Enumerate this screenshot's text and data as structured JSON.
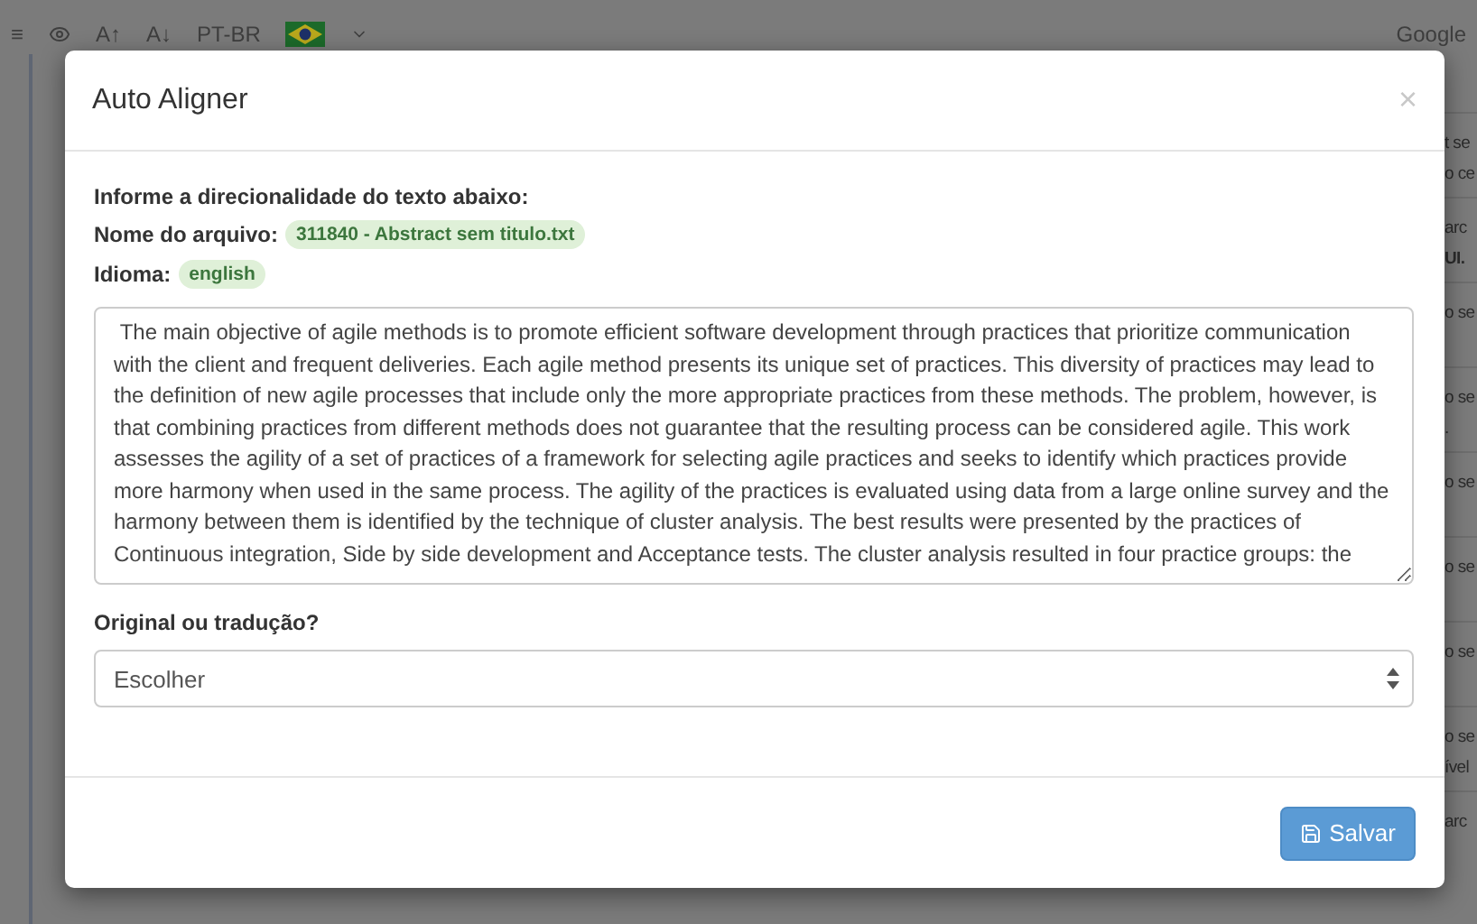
{
  "background": {
    "toolbar": {
      "menu": "≡",
      "font_up": "A↑",
      "font_down": "A↓",
      "language": "PT-BR",
      "right_text": "Google"
    },
    "side_rows": [
      {
        "lines": [
          "t se",
          "o ce"
        ]
      },
      {
        "lines": [
          "arc",
          "**UI.**"
        ]
      },
      {
        "lines": [
          "o se"
        ]
      },
      {
        "lines": [
          "o se",
          "."
        ]
      },
      {
        "lines": [
          "o se"
        ]
      },
      {
        "lines": [
          "o se"
        ]
      },
      {
        "lines": [
          "o se"
        ]
      },
      {
        "lines": [
          "o se",
          "ível"
        ]
      },
      {
        "lines": [
          "arc"
        ]
      }
    ]
  },
  "modal": {
    "title": "Auto Aligner",
    "close": "×",
    "instruction": "Informe a direcionalidade do texto abaixo:",
    "file": {
      "label": "Nome do arquivo:",
      "value": "311840 - Abstract sem titulo.txt"
    },
    "language": {
      "label": "Idioma:",
      "value": "english"
    },
    "text": " The main objective of agile methods is to promote efficient software development through practices that prioritize communication with the client and frequent deliveries. Each agile method presents its unique set of practices. This diversity of practices may lead to the definition of new agile processes that include only the more appropriate practices from these methods. The problem, however, is that combining practices from different methods does not guarantee that the resulting process can be considered agile. This work assesses the agility of a set of practices of a framework for selecting agile practices and seeks to identify which practices provide more harmony when used in the same process. The agility of the practices is evaluated using data from a large online survey and the harmony between them is identified by the technique of cluster analysis. The best results were presented by the practices of Continuous integration, Side by side development and Acceptance tests. The cluster analysis resulted in four practice groups: the",
    "direction": {
      "label": "Original ou tradução?",
      "value": "Escolher"
    },
    "save_button": "Salvar"
  }
}
